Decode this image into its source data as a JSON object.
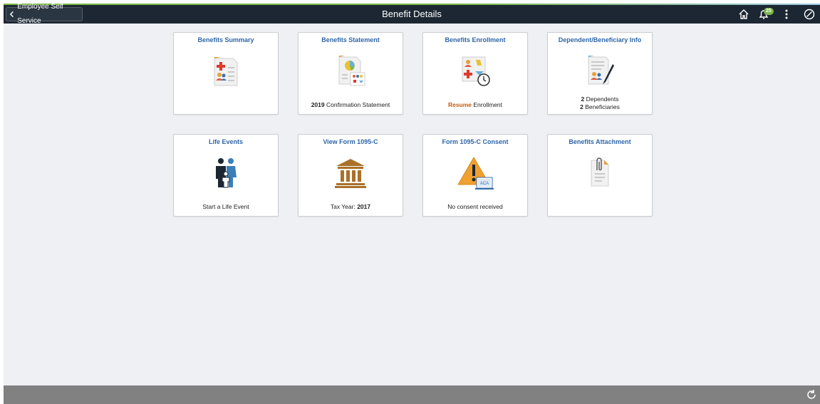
{
  "header": {
    "back_label": "Employee Self Service",
    "title": "Benefit Details",
    "notification_count": "25",
    "icons": [
      "home-icon",
      "bell-icon",
      "actions-menu-icon",
      "navbar-icon"
    ]
  },
  "tiles": [
    {
      "title": "Benefits Summary",
      "icon": "benefits-summary-icon"
    },
    {
      "title": "Benefits Statement",
      "icon": "benefits-statement-icon",
      "line1_strong": "2019",
      "line1_rest": " Confirmation Statement"
    },
    {
      "title": "Benefits Enrollment",
      "icon": "benefits-enrollment-icon",
      "line1_strong": "Resume",
      "line1_rest": " Enrollment"
    },
    {
      "title": "Dependent/Beneficiary Info",
      "icon": "dependent-info-icon",
      "line1_strong": "2",
      "line1_rest": " Dependents",
      "line2_strong": "2",
      "line2_rest": " Beneficiaries"
    },
    {
      "title": "Life Events",
      "icon": "family-icon",
      "line1_rest": "Start a Life Event"
    },
    {
      "title": "View Form 1095-C",
      "icon": "bank-building-icon",
      "line1_rest": "Tax Year: ",
      "line1_strong_after": "2017"
    },
    {
      "title": "Form 1095-C Consent",
      "icon": "warning-aca-icon",
      "line1_rest": "No consent received",
      "aca_label": "ACA"
    },
    {
      "title": "Benefits Attachment",
      "icon": "attachment-icon"
    }
  ],
  "colors": {
    "header_bg": "#1d2733",
    "tile_title": "#2f66a8",
    "accent_orange": "#c25b0f",
    "footer_bg": "#818181"
  }
}
